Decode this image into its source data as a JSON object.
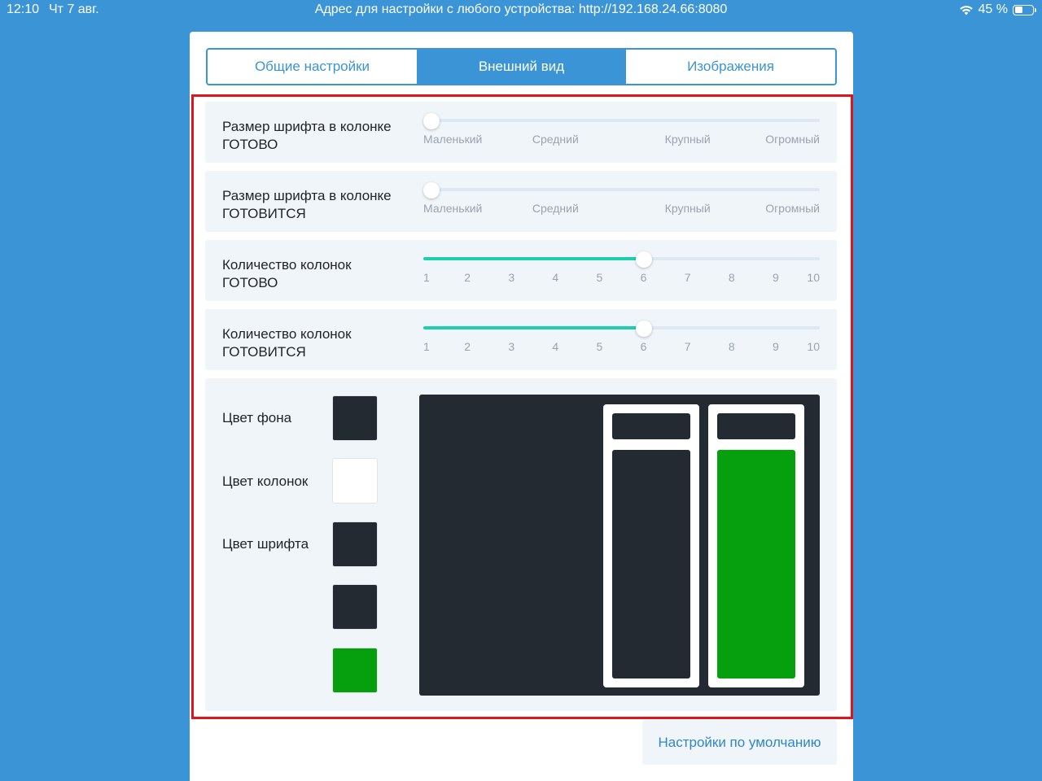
{
  "status_bar": {
    "time": "12:10",
    "date": "Чт 7 авг.",
    "address": "Адрес для настройки с любого устройства: http://192.168.24.66:8080",
    "battery": "45 %",
    "battery_level": 0.45,
    "wifi_icon": "wifi-icon"
  },
  "tabs": [
    {
      "label": "Общие настройки",
      "active": false
    },
    {
      "label": "Внешний вид",
      "active": true
    },
    {
      "label": "Изображения",
      "active": false
    }
  ],
  "settings": {
    "font_size_ready": {
      "label_line1": "Размер шрифта в колонке",
      "label_line2": "ГОТОВО",
      "options": [
        "Маленький",
        "Средний",
        "Крупный",
        "Огромный"
      ],
      "selected": "Маленький"
    },
    "font_size_cooking": {
      "label_line1": "Размер шрифта в колонке",
      "label_line2": "ГОТОВИТСЯ",
      "options": [
        "Маленький",
        "Средний",
        "Крупный",
        "Огромный"
      ],
      "selected": "Маленький"
    },
    "columns_ready": {
      "label_line1": "Количество колонок",
      "label_line2": "ГОТОВО",
      "options": [
        "1",
        "2",
        "3",
        "4",
        "5",
        "6",
        "7",
        "8",
        "9",
        "10"
      ],
      "selected": "6"
    },
    "columns_cooking": {
      "label_line1": "Количество колонок",
      "label_line2": "ГОТОВИТСЯ",
      "options": [
        "1",
        "2",
        "3",
        "4",
        "5",
        "6",
        "7",
        "8",
        "9",
        "10"
      ],
      "selected": "6"
    }
  },
  "colors": {
    "background_label": "Цвет фона",
    "columns_label": "Цвет колонок",
    "font_label": "Цвет шрифта",
    "swatches": [
      "#232a31",
      "#ffffff",
      "#232a31",
      "#232a31",
      "#06a00e"
    ],
    "accent": "#3a94d6",
    "slider_fill": "#1ecfae"
  },
  "default_button": "Настройки по умолчанию"
}
